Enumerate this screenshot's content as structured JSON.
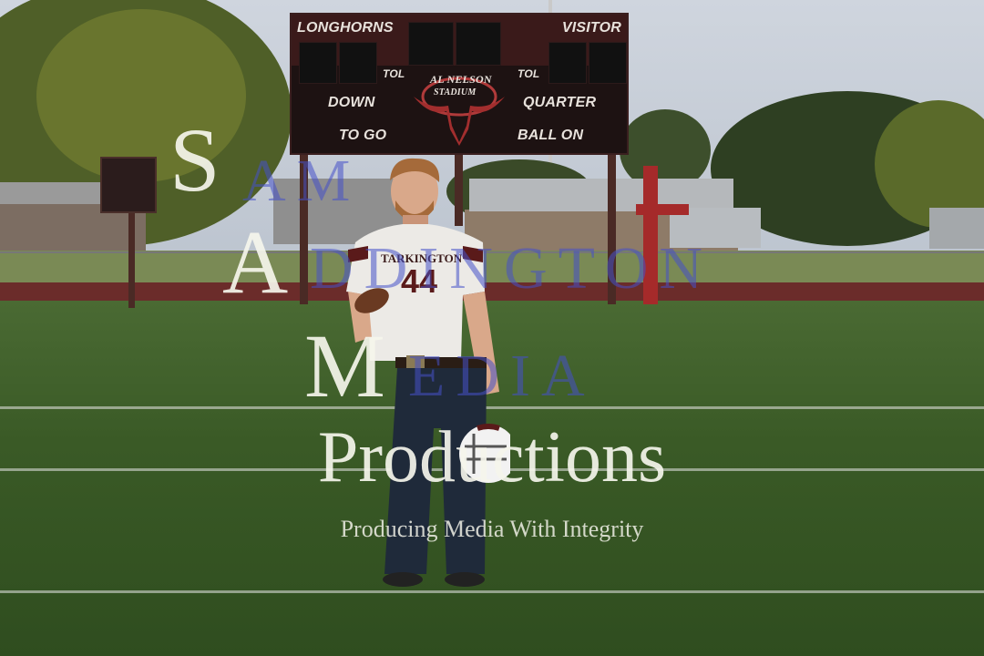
{
  "scoreboard": {
    "home_label": "LONGHORNS",
    "visitor_label": "VISITOR",
    "tol_left": "TOL",
    "tol_right": "TOL",
    "down_label": "DOWN",
    "quarter_label": "QUARTER",
    "to_go_label": "TO GO",
    "ball_on_label": "BALL ON",
    "stadium_name": "AL NELSON",
    "stadium_word": "STADIUM"
  },
  "player": {
    "jersey_team": "TARKINGTON",
    "jersey_number": "44"
  },
  "watermark": {
    "line1_initial": "S",
    "line1_rest": "AM",
    "line2_initial": "A",
    "line2_rest": "DDINGTON",
    "line3_initial": "M",
    "line3_rest": "EDIA",
    "line4": "Productions",
    "tagline": "Producing Media With Integrity"
  },
  "colors": {
    "maroon": "#6b1f1f",
    "watermark_blue": "#4650c8",
    "cross_red": "#a52a2a"
  }
}
